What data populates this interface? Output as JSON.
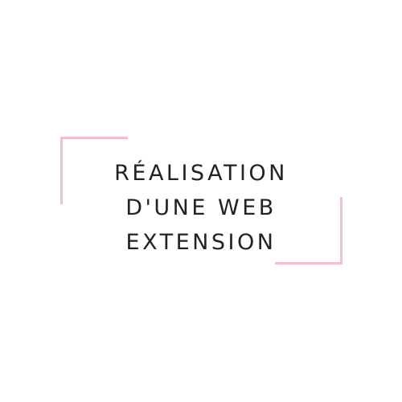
{
  "title_lines": [
    "RÉALISATION",
    "D'UNE WEB",
    "EXTENSION"
  ],
  "colors": {
    "background": "#ffffff",
    "text": "#222222",
    "accent_frame": "#f4bfcc"
  }
}
